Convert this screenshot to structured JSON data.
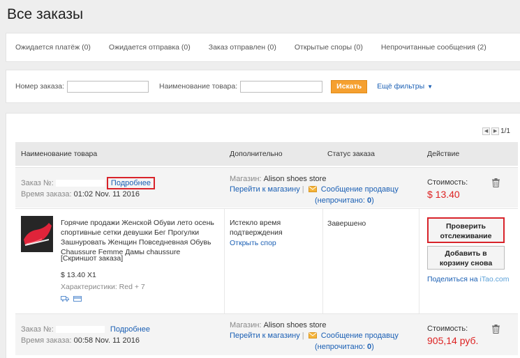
{
  "page": {
    "title": "Все заказы"
  },
  "tabs": [
    {
      "label": "Ожидается платёж (0)"
    },
    {
      "label": "Ожидается отправка (0)"
    },
    {
      "label": "Заказ отправлен (0)"
    },
    {
      "label": "Открытые споры (0)"
    },
    {
      "label": "Непрочитанные сообщения (2)"
    }
  ],
  "filters": {
    "order_number_label": "Номер заказа:",
    "order_number_value": "",
    "product_name_label": "Наименование товара:",
    "product_name_value": "",
    "search_button": "Искать",
    "more_filters": "Ещё фильтры"
  },
  "pagination": {
    "text": "1/1"
  },
  "table": {
    "headers": [
      "Наименование товара",
      "Дополнительно",
      "Статус заказа",
      "Действие"
    ]
  },
  "labels": {
    "order_no": "Заказ №:",
    "order_time": "Время заказа:",
    "details": "Подробнее",
    "store": "Магазин:",
    "go_to_store": "Перейти к магазину",
    "separator": "|",
    "message_seller": "Сообщение продавцу",
    "unread_prefix": "(непрочитано: ",
    "unread_suffix": ")",
    "cost": "Стоимость:"
  },
  "orders": [
    {
      "order_time": "01:02 Nov. 11 2016",
      "store_name": "Alison shoes store",
      "unread_count": "0",
      "price": "$ 13.40",
      "product": {
        "name": "Горячие продажи Женской Обуви лето осень спортивные сетки девушки Бег Прогулки Зашнуровать Женщин Повседневная Обувь Chaussure Femme Дамы chaussure",
        "snapshot": "[Скриншот заказа]",
        "qty_price": "$ 13.40 X1",
        "characteristics": "Характеристики: Red + 7"
      },
      "extra_line1": "Истекло время",
      "extra_line2": "подтверждения",
      "open_dispute": "Открыть спор",
      "status": "Завершено",
      "track_button_line1": "Проверить",
      "track_button_line2": "отслеживание",
      "cart_button_line1": "Добавить в",
      "cart_button_line2": "корзину снова",
      "share_prefix": "Поделиться на",
      "share_site": "iTao.com"
    },
    {
      "order_time": "00:58 Nov. 11 2016",
      "store_name": "Alison shoes store",
      "unread_count": "0",
      "price": "905,14 руб."
    }
  ],
  "colors": {
    "accent_orange": "#f5a030",
    "link_blue": "#1a5fb4",
    "price_red": "#d22222",
    "highlight_red": "#d8232a"
  },
  "icons": [
    "trash-icon",
    "mail-icon",
    "chevron-down-icon",
    "prev-page-icon",
    "next-page-icon",
    "delivery-icon",
    "card-icon"
  ]
}
